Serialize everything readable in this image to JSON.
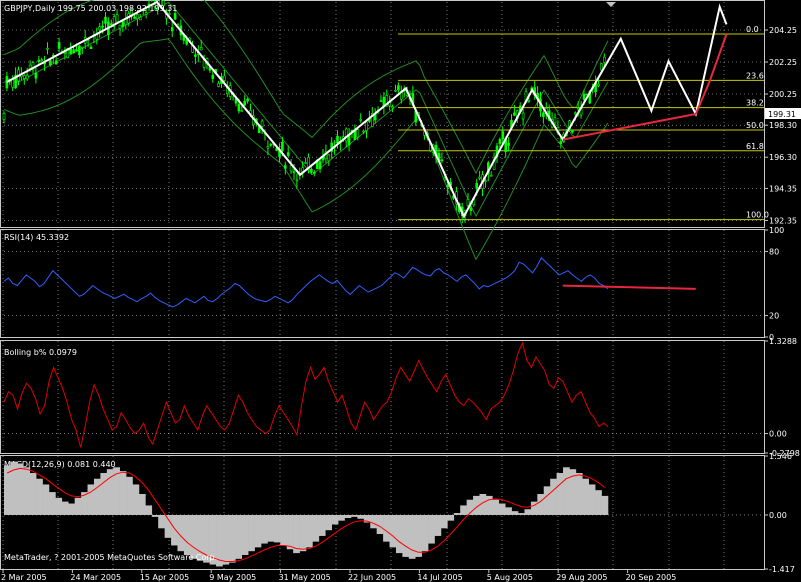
{
  "colors": {
    "background": "#000000",
    "grid": "#c8c8c8",
    "bull": "#00ff00",
    "bear": "#000000",
    "candle_outline": "#00ff00",
    "bands": "#228b22",
    "zigzag": "#ffffff",
    "trend": "#e6283c",
    "fib": "#c8c800",
    "rsi": "#3060ff",
    "bolling": "#e00000",
    "macd_hist": "#c0c0c0",
    "macd_signal": "#ff0000",
    "text": "#ffffff",
    "price_box": "#ffffff"
  },
  "chart_data": [
    {
      "panel": "price",
      "type": "candlestick",
      "title": "GBPJPY,Daily  199.75 200.03 198.92 199.31",
      "ylim": [
        192.0,
        206.0
      ],
      "y_ticks": [
        "204.25",
        "202.25",
        "200.25",
        "198.30",
        "196.30",
        "194.35",
        "192.35"
      ],
      "current_price": "199.31",
      "zigzag_points": [
        [
          "2005-03-02",
          201.0
        ],
        [
          "2005-04-15",
          206.0
        ],
        [
          "2005-05-27",
          195.2
        ],
        [
          "2005-06-27",
          200.6
        ],
        [
          "2005-07-14",
          192.6
        ],
        [
          "2005-08-03",
          200.5
        ],
        [
          "2005-08-12",
          197.4
        ],
        [
          "2005-08-29",
          203.7
        ],
        [
          "2005-09-07",
          199.2
        ],
        [
          "2005-09-12",
          202.3
        ],
        [
          "2005-09-20",
          199.0
        ],
        [
          "2005-09-27",
          205.7
        ],
        [
          "2005-09-29",
          204.6
        ]
      ],
      "forecast_points": [
        [
          "2005-09-20",
          199.0
        ],
        [
          "2005-09-24",
          201.0
        ],
        [
          "2005-09-29",
          204.0
        ]
      ],
      "trendline": [
        [
          "2005-08-12",
          197.4
        ],
        [
          "2005-09-20",
          199.0
        ]
      ],
      "fib_levels": [
        {
          "label": "0.0",
          "value": 204.0
        },
        {
          "label": "23.6",
          "value": 201.1
        },
        {
          "label": "38.2",
          "value": 199.4
        },
        {
          "label": "50.0",
          "value": 198.0
        },
        {
          "label": "61.8",
          "value": 196.7
        },
        {
          "label": "100.0",
          "value": 192.4
        }
      ]
    },
    {
      "panel": "rsi",
      "type": "line",
      "title": "RSI(14) 45.3392",
      "ylim": [
        0,
        100
      ],
      "y_ticks": [
        "100",
        "80",
        "20",
        "0"
      ],
      "levels": [
        80,
        20
      ],
      "trendline": [
        [
          "2005-08-12",
          48
        ],
        [
          "2005-09-20",
          45
        ]
      ],
      "series": [
        {
          "values": [
            52,
            55,
            50,
            48,
            53,
            58,
            55,
            52,
            47,
            50,
            56,
            62,
            58,
            54,
            50,
            46,
            42,
            38,
            40,
            44,
            48,
            45,
            42,
            40,
            38,
            36,
            38,
            40,
            37,
            35,
            33,
            36,
            38,
            41,
            37,
            34,
            32,
            30,
            28,
            30,
            33,
            36,
            34,
            32,
            35,
            38,
            34,
            33,
            36,
            40,
            43,
            46,
            50,
            48,
            44,
            40,
            37,
            35,
            34,
            33,
            35,
            38,
            36,
            34,
            32,
            35,
            40,
            44,
            48,
            52,
            55,
            58,
            55,
            52,
            50,
            53,
            48,
            43,
            40,
            44,
            48,
            45,
            42,
            44,
            46,
            48,
            52,
            56,
            60,
            58,
            55,
            60,
            65,
            63,
            60,
            58,
            57,
            62,
            64,
            60,
            58,
            55,
            52,
            56,
            58,
            54,
            50,
            45,
            48,
            47,
            49,
            51,
            53,
            55,
            58,
            62,
            70,
            68,
            64,
            60,
            66,
            74,
            70,
            66,
            62,
            58,
            60,
            62,
            58,
            55,
            52,
            56,
            58,
            55,
            50,
            48,
            45
          ]
        }
      ]
    },
    {
      "panel": "bolling",
      "type": "line",
      "title": "Bolling b%  0.0979",
      "ylim": [
        -0.2798,
        1.3288
      ],
      "y_ticks": [
        "1.3288",
        "0.00",
        "-0.2798"
      ],
      "series": [
        {
          "values": [
            0.45,
            0.6,
            0.55,
            0.35,
            0.58,
            0.72,
            0.65,
            0.5,
            0.28,
            0.4,
            0.75,
            0.95,
            0.8,
            0.65,
            0.45,
            0.2,
            0.05,
            -0.2,
            0.1,
            0.45,
            0.7,
            0.55,
            0.35,
            0.2,
            0.05,
            0.1,
            0.3,
            0.2,
            0.08,
            0.0,
            0.05,
            0.15,
            -0.05,
            -0.15,
            0.05,
            0.25,
            0.45,
            0.3,
            0.15,
            0.2,
            0.4,
            0.25,
            0.15,
            0.05,
            0.25,
            0.4,
            0.3,
            0.2,
            0.1,
            0.05,
            0.15,
            0.35,
            0.55,
            0.45,
            0.3,
            0.2,
            0.1,
            0.05,
            0.0,
            0.05,
            0.25,
            0.4,
            0.3,
            0.2,
            0.1,
            -0.02,
            0.4,
            0.75,
            0.95,
            0.78,
            0.85,
            0.95,
            0.75,
            0.6,
            0.45,
            0.55,
            0.35,
            0.15,
            0.05,
            0.25,
            0.45,
            0.35,
            0.2,
            0.3,
            0.4,
            0.45,
            0.6,
            0.8,
            0.95,
            0.85,
            0.75,
            0.9,
            1.05,
            0.92,
            0.8,
            0.7,
            0.6,
            0.75,
            0.85,
            0.7,
            0.55,
            0.45,
            0.4,
            0.5,
            0.45,
            0.38,
            0.3,
            0.2,
            0.35,
            0.4,
            0.45,
            0.55,
            0.7,
            0.9,
            1.15,
            1.3,
            1.05,
            0.95,
            1.1,
            1.0,
            0.9,
            0.7,
            0.65,
            0.8,
            0.75,
            0.6,
            0.45,
            0.55,
            0.6,
            0.45,
            0.3,
            0.22,
            0.1,
            0.15,
            0.1
          ]
        }
      ]
    },
    {
      "panel": "macd",
      "type": "bar",
      "title": "MACD(12,26,9) 0.081 0.440",
      "ylim": [
        -1.417,
        1.546
      ],
      "y_ticks": [
        "1.546",
        "0.00",
        "-1.417"
      ],
      "series": [
        {
          "values": [
            1.3,
            1.4,
            1.35,
            1.25,
            1.1,
            0.95,
            0.8,
            0.6,
            0.45,
            0.35,
            0.3,
            0.45,
            0.6,
            0.8,
            0.95,
            1.1,
            1.2,
            1.25,
            1.15,
            1.0,
            0.8,
            0.55,
            0.25,
            -0.05,
            -0.35,
            -0.6,
            -0.8,
            -0.95,
            -1.05,
            -1.15,
            -1.2,
            -1.25,
            -1.3,
            -1.35,
            -1.3,
            -1.25,
            -1.15,
            -1.05,
            -0.95,
            -0.85,
            -0.75,
            -0.7,
            -0.72,
            -0.8,
            -0.9,
            -1.0,
            -0.95,
            -0.85,
            -0.7,
            -0.55,
            -0.4,
            -0.25,
            -0.15,
            -0.08,
            -0.05,
            -0.1,
            -0.2,
            -0.35,
            -0.5,
            -0.7,
            -0.85,
            -1.0,
            -1.1,
            -1.15,
            -1.1,
            -0.95,
            -0.75,
            -0.55,
            -0.35,
            -0.15,
            0.05,
            0.25,
            0.4,
            0.5,
            0.55,
            0.5,
            0.4,
            0.3,
            0.2,
            0.1,
            0.05,
            0.15,
            0.35,
            0.55,
            0.75,
            0.95,
            1.1,
            1.25,
            1.2,
            1.1,
            0.95,
            0.8,
            0.65,
            0.5
          ]
        },
        {
          "values": [
            1.1,
            1.18,
            1.22,
            1.2,
            1.15,
            1.05,
            0.95,
            0.82,
            0.7,
            0.58,
            0.5,
            0.48,
            0.52,
            0.6,
            0.72,
            0.85,
            0.98,
            1.08,
            1.12,
            1.1,
            1.0,
            0.85,
            0.65,
            0.4,
            0.15,
            -0.1,
            -0.35,
            -0.55,
            -0.72,
            -0.85,
            -0.96,
            -1.05,
            -1.12,
            -1.18,
            -1.22,
            -1.22,
            -1.2,
            -1.15,
            -1.08,
            -1.0,
            -0.92,
            -0.85,
            -0.8,
            -0.8,
            -0.82,
            -0.88,
            -0.9,
            -0.88,
            -0.82,
            -0.72,
            -0.6,
            -0.48,
            -0.36,
            -0.26,
            -0.18,
            -0.15,
            -0.16,
            -0.22,
            -0.3,
            -0.42,
            -0.55,
            -0.7,
            -0.82,
            -0.92,
            -0.98,
            -0.98,
            -0.92,
            -0.82,
            -0.68,
            -0.5,
            -0.32,
            -0.12,
            0.05,
            0.2,
            0.32,
            0.4,
            0.42,
            0.4,
            0.35,
            0.28,
            0.22,
            0.2,
            0.25,
            0.35,
            0.5,
            0.65,
            0.8,
            0.95,
            1.02,
            1.05,
            1.02,
            0.95,
            0.85,
            0.72
          ]
        }
      ]
    }
  ],
  "x_axis": {
    "labels": [
      "2 Mar 2005",
      "24 Mar 2005",
      "15 Apr 2005",
      "9 May 2005",
      "31 May 2005",
      "22 Jun 2005",
      "14 Jul 2005",
      "5 Aug 2005",
      "29 Aug 2005",
      "20 Sep 2005"
    ]
  },
  "footer": {
    "copyright": "MetaTrader, ? 2001-2005 MetaQuotes Software Corp."
  }
}
